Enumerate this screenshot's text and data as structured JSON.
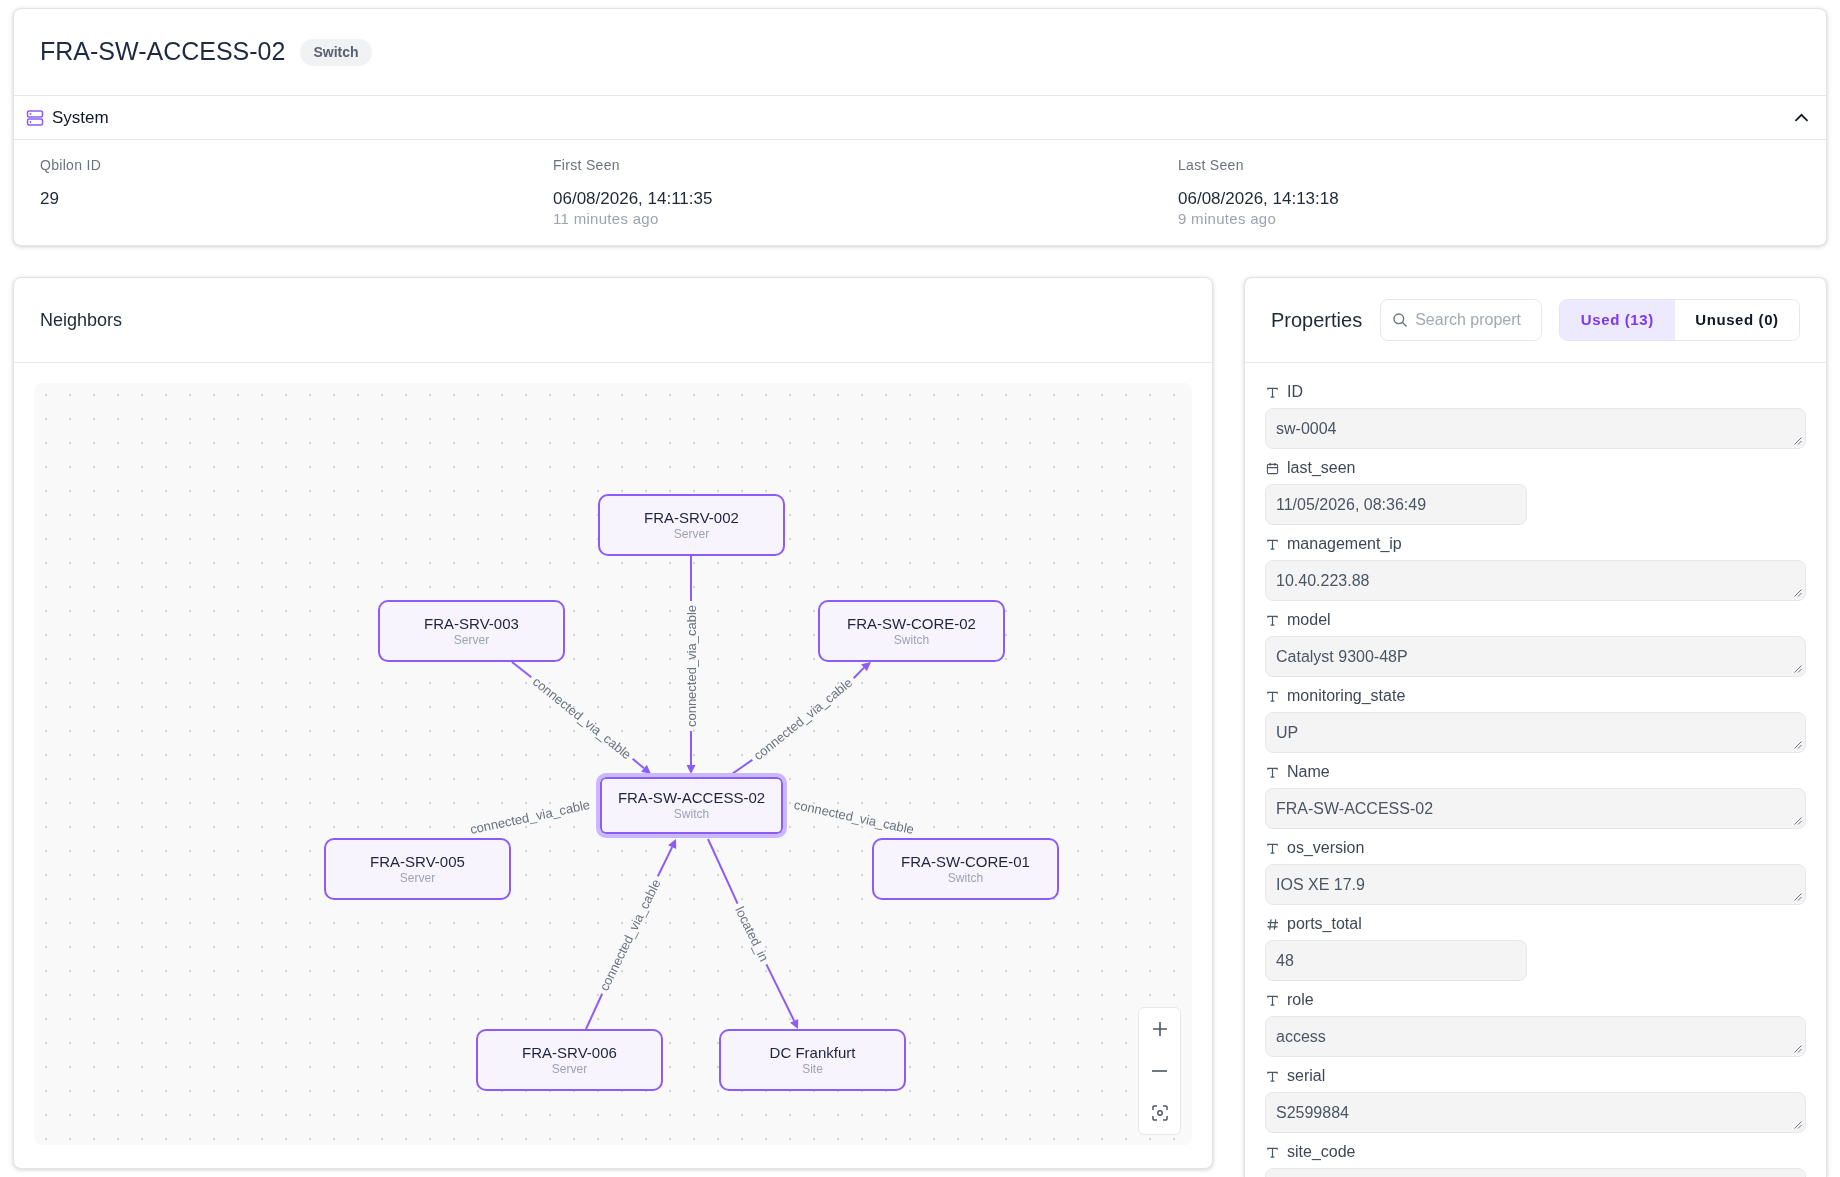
{
  "entity": {
    "title": "FRA-SW-ACCESS-02",
    "badge": "Switch"
  },
  "system_section": {
    "title": "System",
    "expanded": true,
    "fields": [
      {
        "label": "Qbilon ID",
        "value": "29"
      },
      {
        "label": "First Seen",
        "value": "06/08/2026, 14:11:35",
        "relative": "11 minutes ago"
      },
      {
        "label": "Last Seen",
        "value": "06/08/2026, 14:13:18",
        "relative": "9 minutes ago"
      }
    ]
  },
  "neighbors": {
    "title": "Neighbors",
    "nodes": [
      {
        "name": "FRA-SRV-002",
        "type": "Server",
        "selected": false
      },
      {
        "name": "FRA-SRV-003",
        "type": "Server",
        "selected": false
      },
      {
        "name": "FRA-SW-CORE-02",
        "type": "Switch",
        "selected": false
      },
      {
        "name": "FRA-SW-ACCESS-02",
        "type": "Switch",
        "selected": true
      },
      {
        "name": "FRA-SRV-005",
        "type": "Server",
        "selected": false
      },
      {
        "name": "FRA-SW-CORE-01",
        "type": "Switch",
        "selected": false
      },
      {
        "name": "FRA-SRV-006",
        "type": "Server",
        "selected": false
      },
      {
        "name": "DC Frankfurt",
        "type": "Site",
        "selected": false
      }
    ],
    "edges": [
      {
        "label": "connected_via_cable"
      },
      {
        "label": "connected_via_cable"
      },
      {
        "label": "connected_via_cable"
      },
      {
        "label": "connected_via_cable"
      },
      {
        "label": "connected_via_cable"
      },
      {
        "label": "connected_via_cable"
      },
      {
        "label": "located_in"
      }
    ]
  },
  "properties": {
    "title": "Properties",
    "search": {
      "placeholder": "Search propert"
    },
    "filters": [
      {
        "label": "Used (13)",
        "selected": true
      },
      {
        "label": "Unused (0)",
        "selected": false
      }
    ],
    "items": [
      {
        "label": "ID",
        "kind": "text",
        "value": "sw-0004"
      },
      {
        "label": "last_seen",
        "kind": "date",
        "value": "11/05/2026, 08:36:49"
      },
      {
        "label": "management_ip",
        "kind": "text",
        "value": "10.40.223.88"
      },
      {
        "label": "model",
        "kind": "text",
        "value": "Catalyst 9300-48P"
      },
      {
        "label": "monitoring_state",
        "kind": "text",
        "value": "UP"
      },
      {
        "label": "Name",
        "kind": "text",
        "value": "FRA-SW-ACCESS-02"
      },
      {
        "label": "os_version",
        "kind": "text",
        "value": "IOS XE 17.9"
      },
      {
        "label": "ports_total",
        "kind": "number",
        "value": "48"
      },
      {
        "label": "role",
        "kind": "text",
        "value": "access"
      },
      {
        "label": "serial",
        "kind": "text",
        "value": "S2599884"
      },
      {
        "label": "site_code",
        "kind": "text"
      }
    ]
  }
}
